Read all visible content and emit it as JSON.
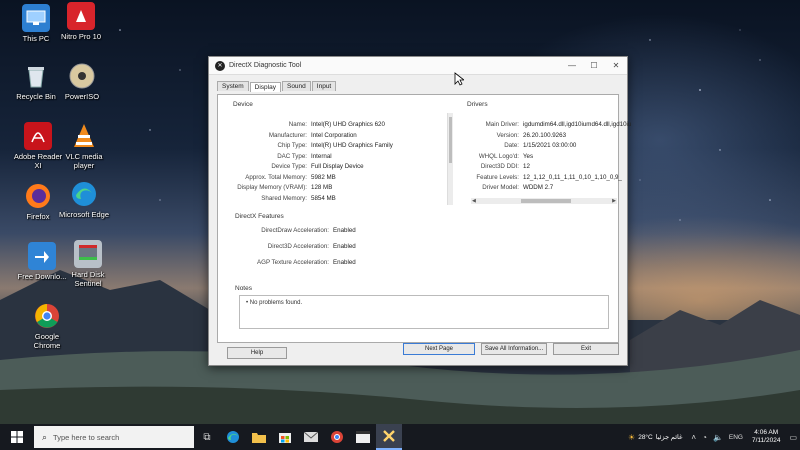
{
  "desktop_icons": [
    {
      "label": "This PC",
      "icon": "this-pc-icon"
    },
    {
      "label": "Nitro Pro 10",
      "icon": "nitro-pro-icon"
    },
    {
      "label": "Recycle Bin",
      "icon": "recycle-bin-icon"
    },
    {
      "label": "PowerISO",
      "icon": "poweriso-icon"
    },
    {
      "label": "Adobe Reader XI",
      "icon": "adobe-reader-icon"
    },
    {
      "label": "VLC media player",
      "icon": "vlc-icon"
    },
    {
      "label": "Firefox",
      "icon": "firefox-icon"
    },
    {
      "label": "Microsoft Edge",
      "icon": "edge-icon"
    },
    {
      "label": "Free Downlo...",
      "icon": "free-download-icon"
    },
    {
      "label": "Hard Disk Sentinel",
      "icon": "hard-disk-sentinel-icon"
    },
    {
      "label": "Google Chrome",
      "icon": "chrome-icon"
    }
  ],
  "window": {
    "title": "DirectX Diagnostic Tool",
    "tabs": [
      "System",
      "Display",
      "Sound",
      "Input"
    ],
    "active_tab": "Display",
    "device": {
      "heading": "Device",
      "rows": [
        {
          "key": "Name:",
          "value": "Intel(R) UHD Graphics 620"
        },
        {
          "key": "Manufacturer:",
          "value": "Intel Corporation"
        },
        {
          "key": "Chip Type:",
          "value": "Intel(R) UHD Graphics Family"
        },
        {
          "key": "DAC Type:",
          "value": "Internal"
        },
        {
          "key": "Device Type:",
          "value": "Full Display Device"
        },
        {
          "key": "Approx. Total Memory:",
          "value": "5982 MB"
        },
        {
          "key": "Display Memory (VRAM):",
          "value": "128 MB"
        },
        {
          "key": "Shared Memory:",
          "value": "5854 MB"
        }
      ]
    },
    "drivers": {
      "heading": "Drivers",
      "rows": [
        {
          "key": "Main Driver:",
          "value": "igdumdim64.dll,igd10iumd64.dll,igd10iu"
        },
        {
          "key": "Version:",
          "value": "26.20.100.9263"
        },
        {
          "key": "Date:",
          "value": "1/15/2021 03:00:00"
        },
        {
          "key": "WHQL Logo'd:",
          "value": "Yes"
        },
        {
          "key": "Direct3D DDI:",
          "value": "12"
        },
        {
          "key": "Feature Levels:",
          "value": "12_1,12_0,11_1,11_0,10_1,10_0,9_"
        },
        {
          "key": "Driver Model:",
          "value": "WDDM 2.7"
        }
      ]
    },
    "features": {
      "heading": "DirectX Features",
      "rows": [
        {
          "key": "DirectDraw Acceleration:",
          "value": "Enabled"
        },
        {
          "key": "Direct3D Acceleration:",
          "value": "Enabled"
        },
        {
          "key": "AGP Texture Acceleration:",
          "value": "Enabled"
        }
      ]
    },
    "notes": {
      "heading": "Notes",
      "items": [
        "No problems found."
      ]
    },
    "buttons": {
      "help": "Help",
      "next_page": "Next Page",
      "save_all": "Save All Information...",
      "exit": "Exit"
    }
  },
  "taskbar": {
    "search_placeholder": "Type here to search",
    "weather": "28°C",
    "weather_text": "غائم جزئيا",
    "language": "ENG",
    "time": "4:06 AM",
    "date": "7/11/2024"
  }
}
